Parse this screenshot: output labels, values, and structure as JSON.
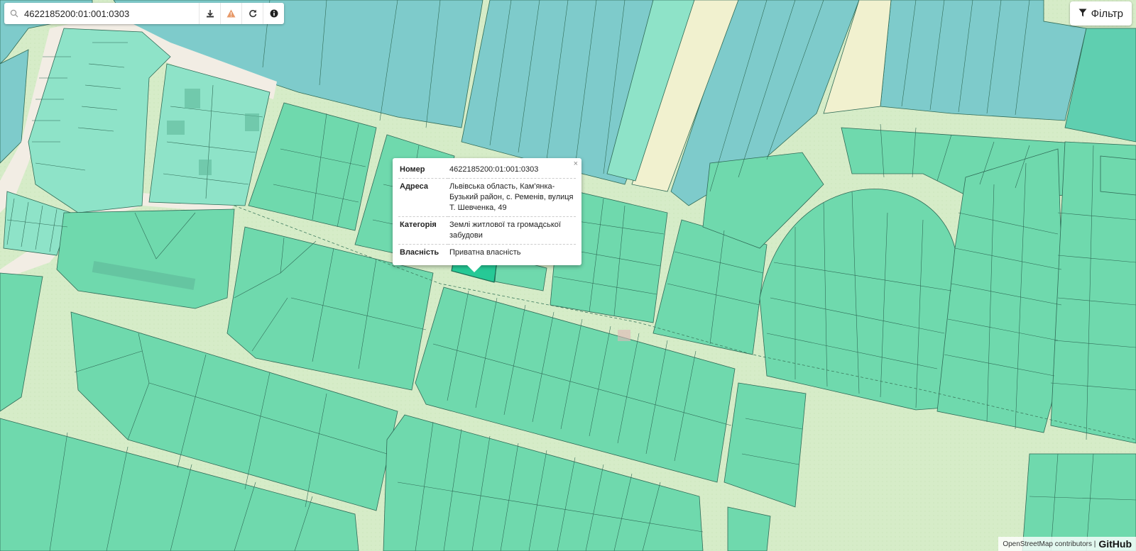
{
  "search": {
    "value": "4622185200:01:001:0303",
    "tools": [
      "download-icon",
      "warning-icon",
      "refresh-icon",
      "info-icon"
    ]
  },
  "filter": {
    "label": "Фільтр",
    "icon": "funnel-icon"
  },
  "popup": {
    "close": "×",
    "rows": [
      {
        "key": "Номер",
        "value": "4622185200:01:001:0303"
      },
      {
        "key": "Адреса",
        "value": "Львівська область, Кам'янка-Бузький район, с. Ременів, вулиця Т. Шевченка, 49"
      },
      {
        "key": "Категорія",
        "value": "Землі житлової та громадської забудови"
      },
      {
        "key": "Власність",
        "value": "Приватна власність"
      }
    ]
  },
  "attribution": {
    "text": "OpenStreetMap contributors |",
    "github": "GitHub"
  },
  "colors": {
    "background": "#d6ecc8",
    "parcel": "#6fd9ad",
    "selected_parcel": "#26c996",
    "water": "#7ecbcb",
    "built": "#8ee3c8",
    "road": "#f2ede4",
    "field": "#f1f1cf"
  }
}
